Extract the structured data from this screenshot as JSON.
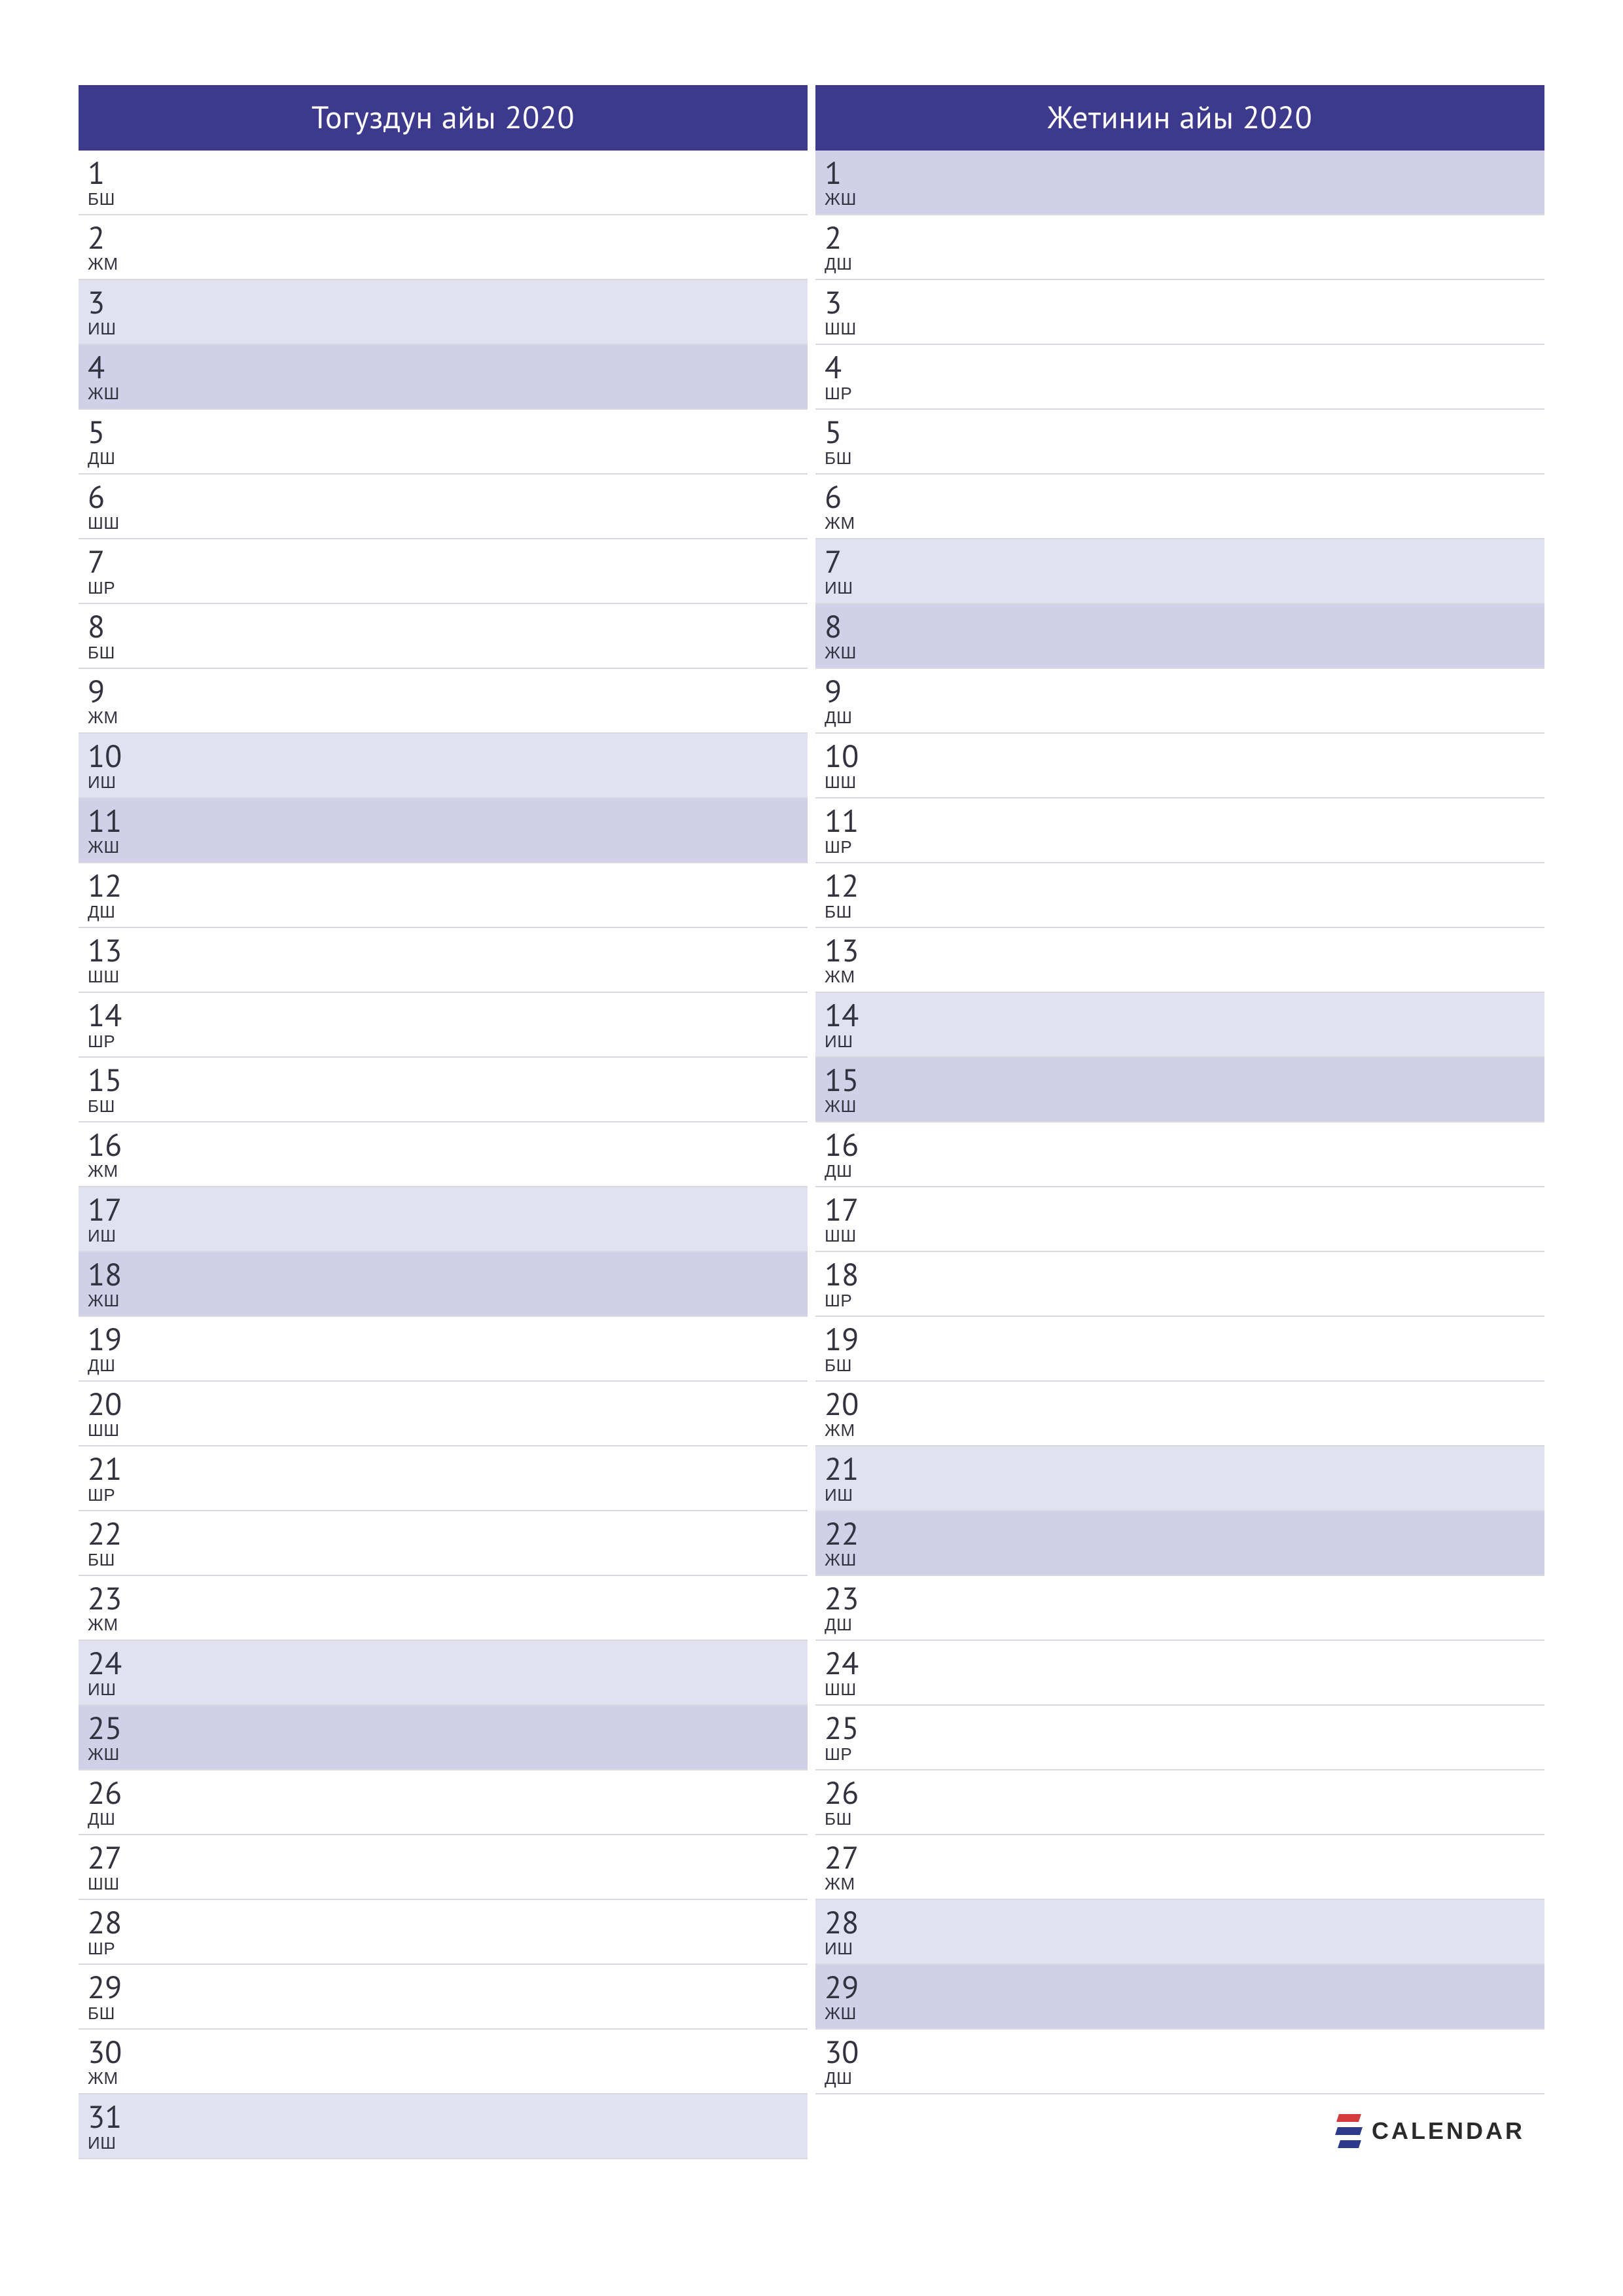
{
  "brand": "CALENDAR",
  "weekdays": {
    "mon": "ДШ",
    "tue": "ШШ",
    "wed": "ШР",
    "thu": "БШ",
    "fri": "ЖМ",
    "sat": "ИШ",
    "sun": "ЖШ"
  },
  "months": [
    {
      "title": "Тогуздун айы 2020",
      "days": [
        {
          "n": "1",
          "d": "thu"
        },
        {
          "n": "2",
          "d": "fri"
        },
        {
          "n": "3",
          "d": "sat"
        },
        {
          "n": "4",
          "d": "sun"
        },
        {
          "n": "5",
          "d": "mon"
        },
        {
          "n": "6",
          "d": "tue"
        },
        {
          "n": "7",
          "d": "wed"
        },
        {
          "n": "8",
          "d": "thu"
        },
        {
          "n": "9",
          "d": "fri"
        },
        {
          "n": "10",
          "d": "sat"
        },
        {
          "n": "11",
          "d": "sun"
        },
        {
          "n": "12",
          "d": "mon"
        },
        {
          "n": "13",
          "d": "tue"
        },
        {
          "n": "14",
          "d": "wed"
        },
        {
          "n": "15",
          "d": "thu"
        },
        {
          "n": "16",
          "d": "fri"
        },
        {
          "n": "17",
          "d": "sat"
        },
        {
          "n": "18",
          "d": "sun"
        },
        {
          "n": "19",
          "d": "mon"
        },
        {
          "n": "20",
          "d": "tue"
        },
        {
          "n": "21",
          "d": "wed"
        },
        {
          "n": "22",
          "d": "thu"
        },
        {
          "n": "23",
          "d": "fri"
        },
        {
          "n": "24",
          "d": "sat"
        },
        {
          "n": "25",
          "d": "sun"
        },
        {
          "n": "26",
          "d": "mon"
        },
        {
          "n": "27",
          "d": "tue"
        },
        {
          "n": "28",
          "d": "wed"
        },
        {
          "n": "29",
          "d": "thu"
        },
        {
          "n": "30",
          "d": "fri"
        },
        {
          "n": "31",
          "d": "sat"
        }
      ]
    },
    {
      "title": "Жетинин айы 2020",
      "days": [
        {
          "n": "1",
          "d": "sun"
        },
        {
          "n": "2",
          "d": "mon"
        },
        {
          "n": "3",
          "d": "tue"
        },
        {
          "n": "4",
          "d": "wed"
        },
        {
          "n": "5",
          "d": "thu"
        },
        {
          "n": "6",
          "d": "fri"
        },
        {
          "n": "7",
          "d": "sat"
        },
        {
          "n": "8",
          "d": "sun"
        },
        {
          "n": "9",
          "d": "mon"
        },
        {
          "n": "10",
          "d": "tue"
        },
        {
          "n": "11",
          "d": "wed"
        },
        {
          "n": "12",
          "d": "thu"
        },
        {
          "n": "13",
          "d": "fri"
        },
        {
          "n": "14",
          "d": "sat"
        },
        {
          "n": "15",
          "d": "sun"
        },
        {
          "n": "16",
          "d": "mon"
        },
        {
          "n": "17",
          "d": "tue"
        },
        {
          "n": "18",
          "d": "wed"
        },
        {
          "n": "19",
          "d": "thu"
        },
        {
          "n": "20",
          "d": "fri"
        },
        {
          "n": "21",
          "d": "sat"
        },
        {
          "n": "22",
          "d": "sun"
        },
        {
          "n": "23",
          "d": "mon"
        },
        {
          "n": "24",
          "d": "tue"
        },
        {
          "n": "25",
          "d": "wed"
        },
        {
          "n": "26",
          "d": "thu"
        },
        {
          "n": "27",
          "d": "fri"
        },
        {
          "n": "28",
          "d": "sat"
        },
        {
          "n": "29",
          "d": "sun"
        },
        {
          "n": "30",
          "d": "mon"
        }
      ]
    }
  ]
}
